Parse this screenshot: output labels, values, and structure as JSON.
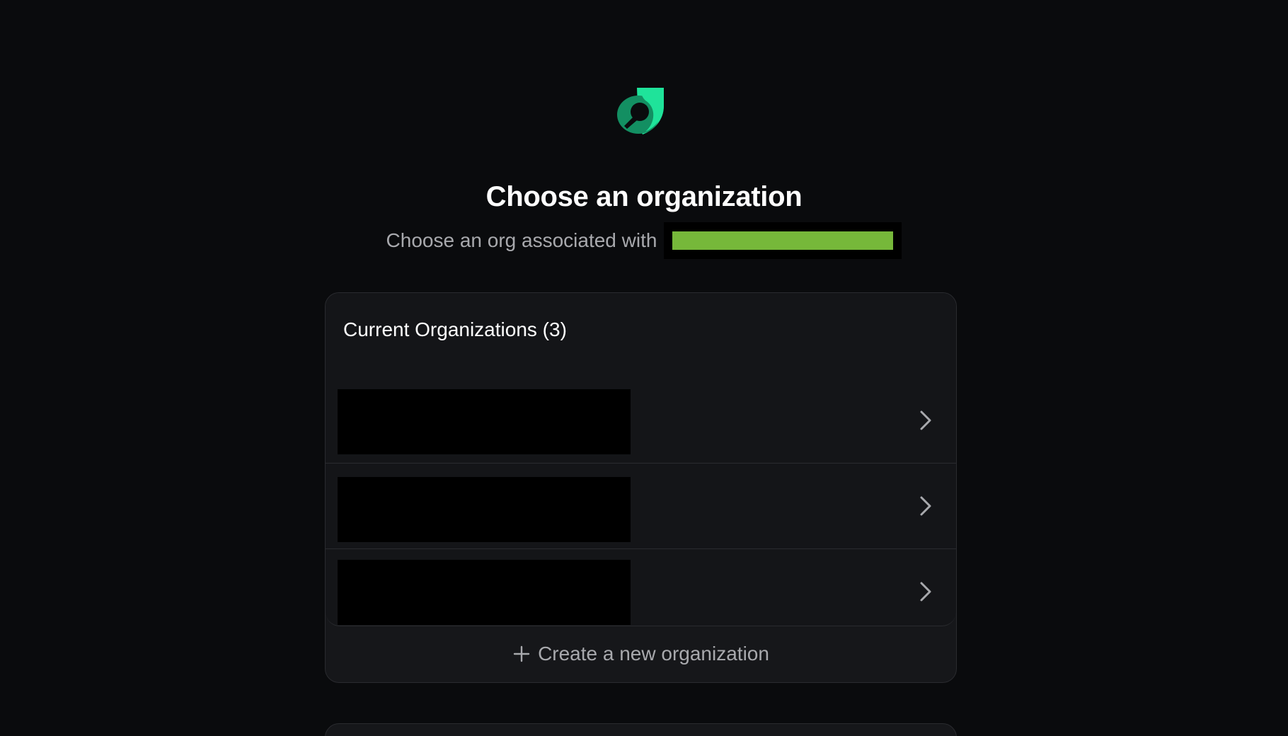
{
  "brand": {
    "logo_icon": "leaf-logo-icon",
    "colors": {
      "logo_light": "#1fe39a",
      "logo_dark": "#138f62",
      "background": "#0a0b0d",
      "card": "#16171a",
      "redaction_highlight": "#76b83a"
    }
  },
  "header": {
    "title": "Choose an organization",
    "subtitle": "Choose an org associated with"
  },
  "organizations": {
    "heading": "Current Organizations (3)",
    "items": [
      {
        "name": ""
      },
      {
        "name": ""
      },
      {
        "name": ""
      }
    ],
    "row_icon": "chevron-right-icon",
    "create_label": "Create a new organization",
    "create_icon": "plus-icon"
  }
}
